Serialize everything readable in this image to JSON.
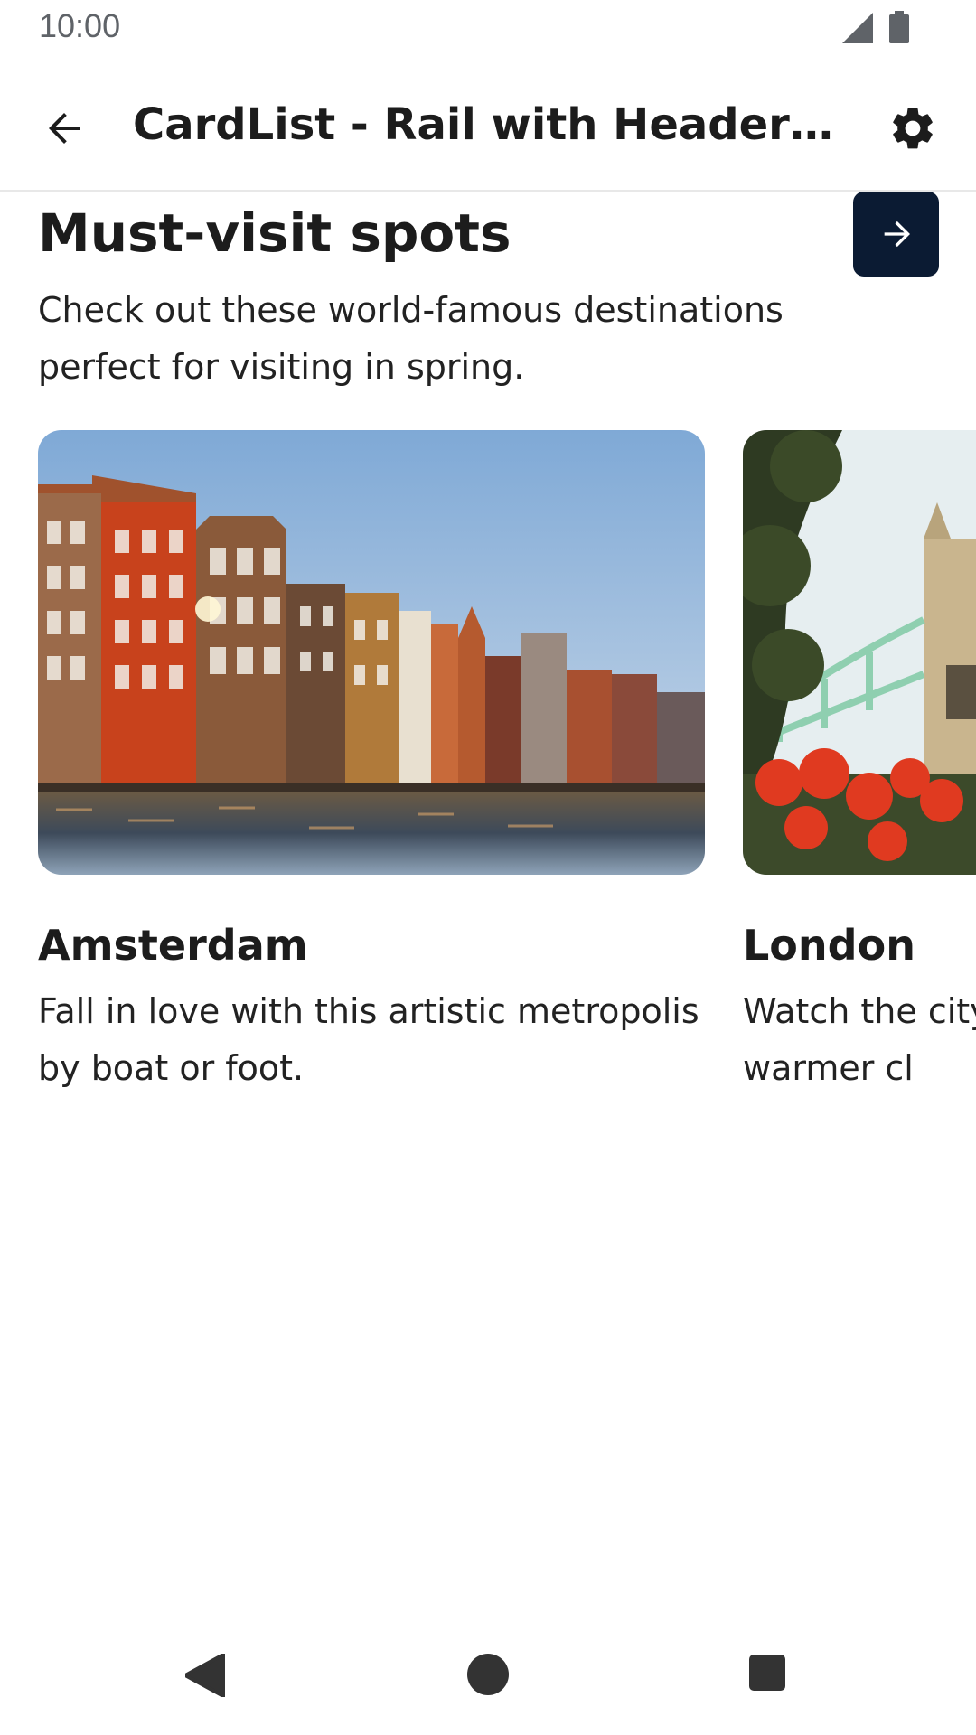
{
  "status_bar": {
    "time": "10:00"
  },
  "app_bar": {
    "title": "CardList - Rail with HeaderButt…"
  },
  "section": {
    "title": "Must-visit spots",
    "subtitle": "Check out these world-famous destinations perfect for visiting in spring."
  },
  "cards": [
    {
      "title": "Amsterdam",
      "description": "Fall in love with this artistic metropolis by boat or foot."
    },
    {
      "title": "London",
      "description": "Watch the city come alive with the warmer cl"
    }
  ],
  "icons": {
    "back": "arrow-left-icon",
    "settings": "gear-icon",
    "header_button": "arrow-right-icon",
    "signal": "signal-icon",
    "battery": "battery-icon"
  },
  "colors": {
    "header_button_bg": "#0b1b33",
    "text": "#1c1c1c"
  }
}
